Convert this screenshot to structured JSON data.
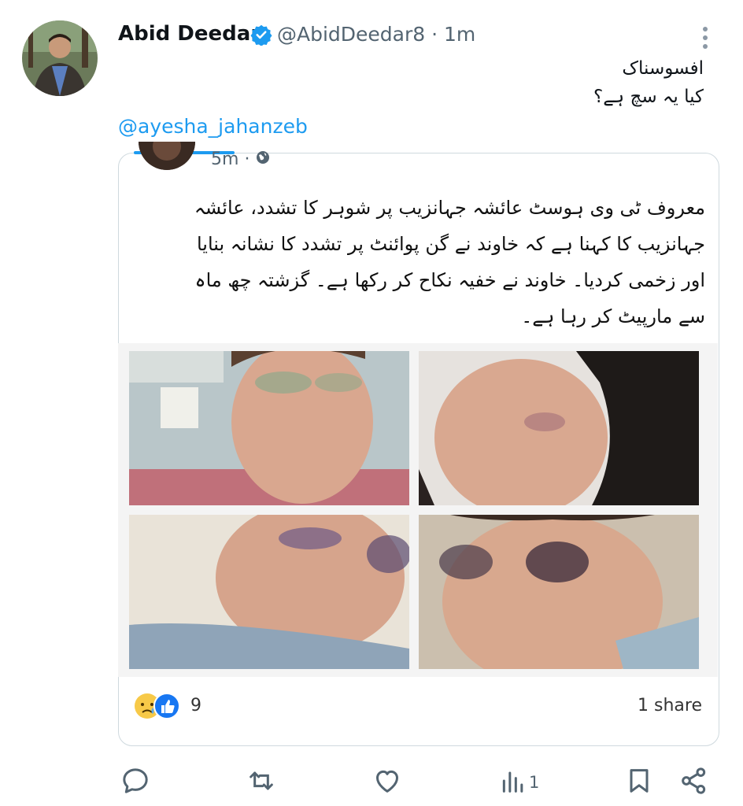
{
  "post": {
    "author_name": "Abid Deedar",
    "author_handle": "@AbidDeedar8",
    "separator": "·",
    "time": "1m",
    "text_line1": "افسوسناک",
    "text_line2": "کیا یہ سچ ہے؟",
    "mention": "@ayesha_jahanzeb"
  },
  "embedded": {
    "time": "5m",
    "separator": "·",
    "lines": [
      "معروف ٹی وی ہوسٹ عائشہ جہانزیب پر شوہر کا تشدد، عائشہ",
      "جہانزیب کا کہنا ہے کہ خاوند نے گن پوائنٹ پر تشدد کا نشانہ بنایا",
      "اور زخمی کردیا۔ خاوند نے خفیہ نکاح کر رکھا ہے۔ گزشتہ چھ ماہ",
      "سے مارپیٹ کر رہا ہے۔"
    ],
    "reaction_count": "9",
    "share_count": "1 share"
  },
  "actions": {
    "views_count": "1"
  },
  "icons": {
    "verified": "verified-badge-icon",
    "more": "more-vertical-icon",
    "globe": "globe-icon",
    "reply": "reply-icon",
    "repost": "repost-icon",
    "like": "like-icon",
    "views": "views-icon",
    "bookmark": "bookmark-icon",
    "share": "share-icon"
  },
  "colors": {
    "link": "#1d9bf0",
    "muted": "#536471",
    "text": "#0f1419"
  }
}
